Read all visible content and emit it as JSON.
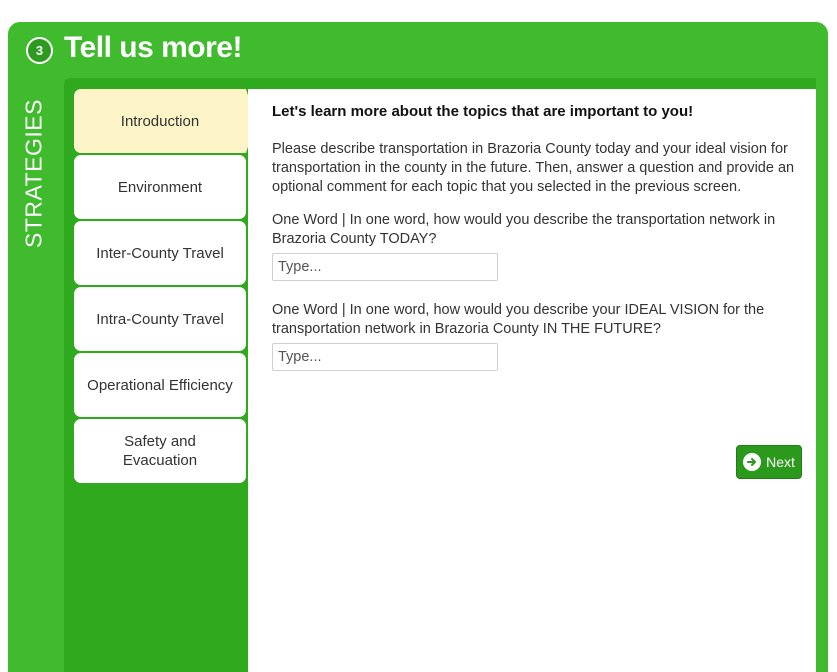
{
  "header": {
    "step_number": "3",
    "title": "Tell us more!"
  },
  "rail": {
    "label": "STRATEGIES"
  },
  "tabs": [
    {
      "label": "Introduction",
      "active": true
    },
    {
      "label": "Environment",
      "active": false
    },
    {
      "label": "Inter-County Travel",
      "active": false
    },
    {
      "label": "Intra-County Travel",
      "active": false
    },
    {
      "label": "Operational Efficiency",
      "active": false
    },
    {
      "label": "Safety and Evacuation",
      "active": false
    }
  ],
  "content": {
    "heading": "Let's learn more about the topics that are important to you!",
    "intro": "Please describe transportation in Brazoria County today and your ideal vision for transportation in the county in the future. Then, answer a question and provide an optional comment for each topic that you selected in the previous screen.",
    "question_today": "One Word | In one word, how would you describe the transportation network in Brazoria County TODAY?",
    "input_today": {
      "value": "",
      "placeholder": "Type..."
    },
    "question_future": "One Word | In one word, how would you describe your IDEAL VISION for the transportation network in Brazoria County IN THE FUTURE?",
    "input_future": {
      "value": "",
      "placeholder": "Type..."
    }
  },
  "next_button": {
    "label": "Next",
    "icon": "arrow-right-circle-icon"
  },
  "colors": {
    "frame_green": "#3fbb2d",
    "panel_green": "#2faa1f",
    "active_tab": "#fdf5c8",
    "button_green": "#2b9a1c"
  }
}
